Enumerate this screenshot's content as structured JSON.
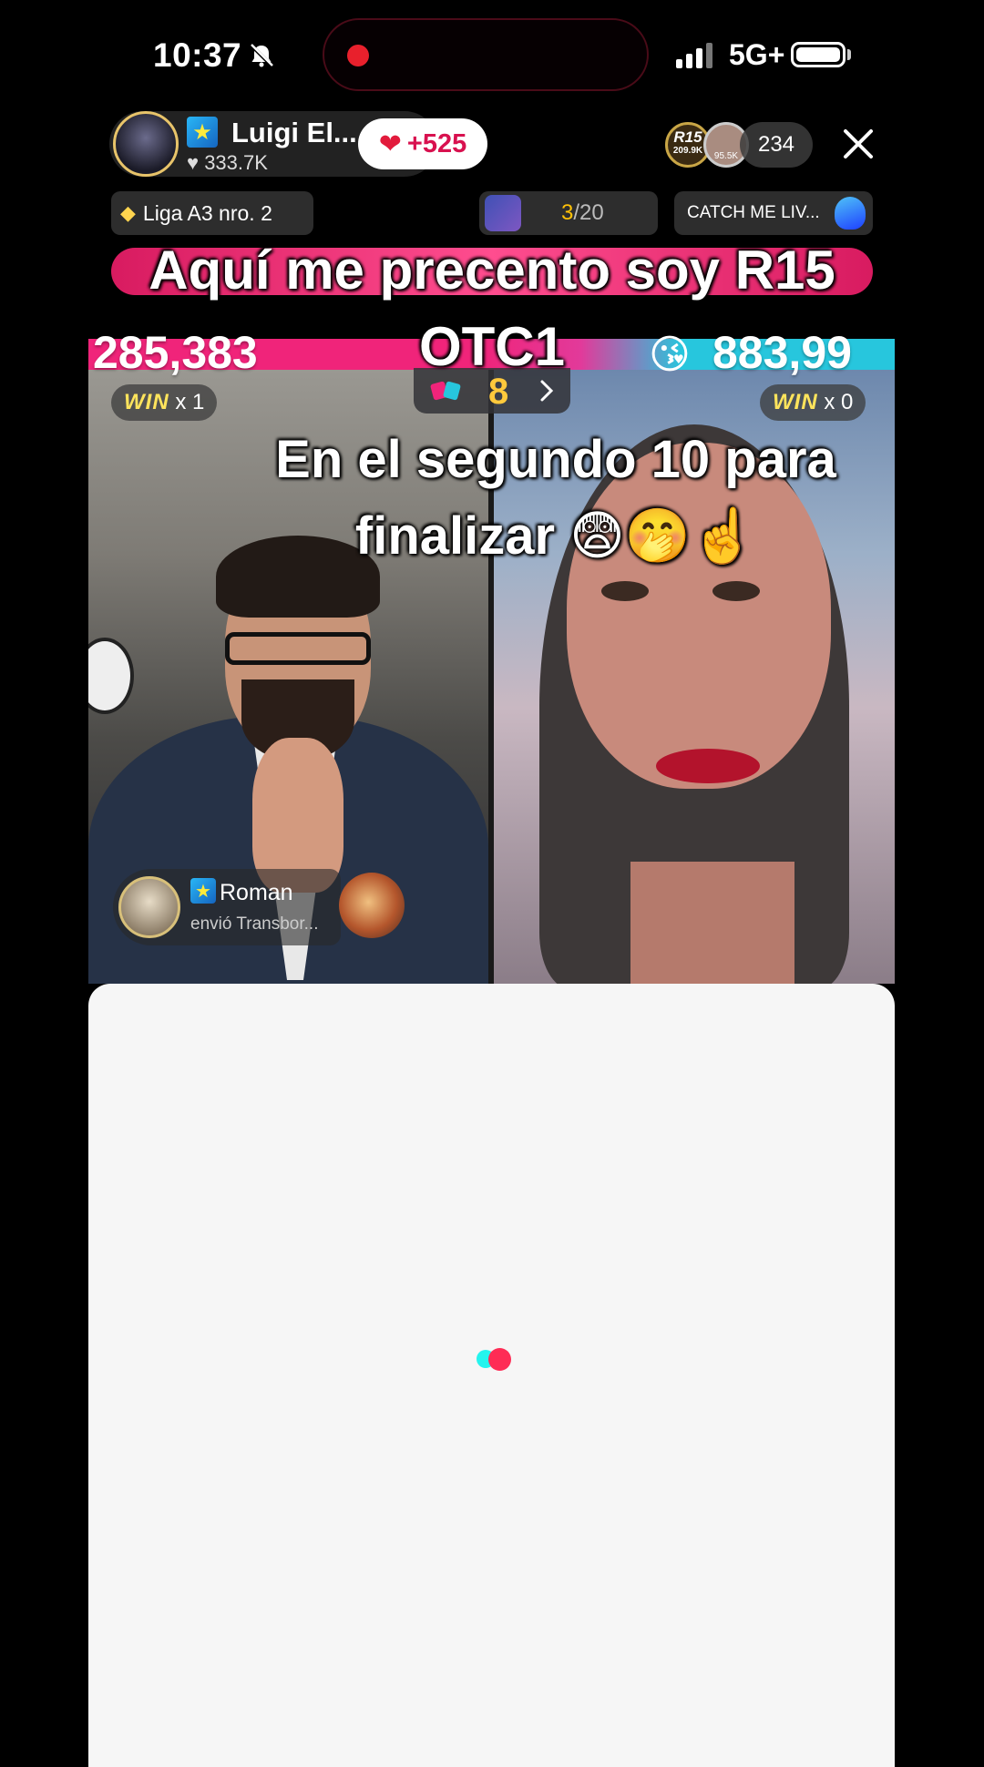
{
  "status_bar": {
    "time": "10:37",
    "network": "5G+"
  },
  "host": {
    "name": "Luigi El...",
    "likes": "333.7K",
    "like_boost": "+525"
  },
  "viewers": {
    "top_viewer_label": "R15",
    "top_viewer_score": "209.9K",
    "second_viewer_score": "95.5K",
    "count": "234"
  },
  "league": {
    "label": "Liga A3 nro. 2"
  },
  "ranking": {
    "current": "3",
    "total": "/20"
  },
  "promo": {
    "label": "CATCH ME LIV..."
  },
  "battle": {
    "score_left": "285,383",
    "score_right": "883,99",
    "timer_value": "8",
    "win_label": "WIN",
    "left_wins": "x 1",
    "right_wins": "x 0"
  },
  "captions": {
    "line1": "Aquí me precento soy R15",
    "line1b": "OTC1",
    "line2": "En el segundo 10 para",
    "line2b": "finalizar 😨🤭☝️"
  },
  "gift_notification": {
    "user": "Roman",
    "message": "envió Transbor..."
  },
  "colors": {
    "left_team": "#f0247a",
    "right_team": "#27c6dd",
    "timer": "#ffc93c",
    "like": "#d8114f"
  }
}
